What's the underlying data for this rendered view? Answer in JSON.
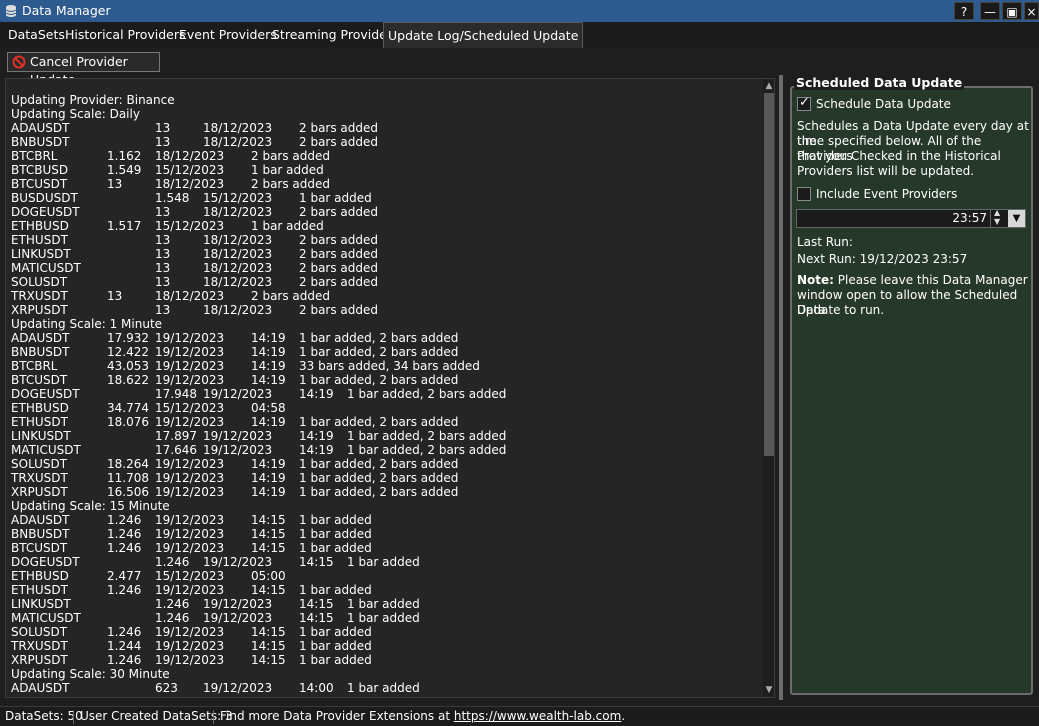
{
  "window": {
    "title": "Data Manager",
    "help": "?",
    "minimize": "—",
    "maximize": "▣",
    "close": "×"
  },
  "tabs": [
    {
      "label": "DataSets"
    },
    {
      "label": "Historical Providers"
    },
    {
      "label": "Event Providers"
    },
    {
      "label": "Streaming Providers"
    },
    {
      "label": "Update Log/Scheduled Update",
      "active": true
    }
  ],
  "toolbar": {
    "cancel_label": "Cancel Provider Update",
    "cancel_icon": "prohibited-icon"
  },
  "log": {
    "provider_line": "Updating Provider: Binance",
    "sections": [
      {
        "header": "Updating Scale: Daily",
        "rows": [
          [
            "ADAUSDT",
            "13",
            "18/12/2023",
            "",
            "2 bars added"
          ],
          [
            "BNBUSDT",
            "13",
            "18/12/2023",
            "",
            "2 bars added"
          ],
          [
            "BTCBRL",
            "1.162",
            "18/12/2023",
            "",
            "2 bars added"
          ],
          [
            "BTCBUSD",
            "1.549",
            "15/12/2023",
            "",
            "1 bar added"
          ],
          [
            "BTCUSDT",
            "13",
            "18/12/2023",
            "",
            "2 bars added"
          ],
          [
            "BUSDUSDT",
            "1.548",
            "15/12/2023",
            "",
            "1 bar added"
          ],
          [
            "DOGEUSDT",
            "13",
            "18/12/2023",
            "",
            "2 bars added"
          ],
          [
            "ETHBUSD",
            "1.517",
            "15/12/2023",
            "",
            "1 bar added"
          ],
          [
            "ETHUSDT",
            "13",
            "18/12/2023",
            "",
            "2 bars added"
          ],
          [
            "LINKUSDT",
            "13",
            "18/12/2023",
            "",
            "2 bars added"
          ],
          [
            "MATICUSDT",
            "13",
            "18/12/2023",
            "",
            "2 bars added"
          ],
          [
            "SOLUSDT",
            "13",
            "18/12/2023",
            "",
            "2 bars added"
          ],
          [
            "TRXUSDT",
            "13",
            "18/12/2023",
            "",
            "2 bars added"
          ],
          [
            "XRPUSDT",
            "13",
            "18/12/2023",
            "",
            "2 bars added"
          ]
        ]
      },
      {
        "header": "Updating Scale: 1 Minute",
        "rows": [
          [
            "ADAUSDT",
            "17.932",
            "19/12/2023",
            "14:19",
            "1 bar added, 2 bars added"
          ],
          [
            "BNBUSDT",
            "12.422",
            "19/12/2023",
            "14:19",
            "1 bar added, 2 bars added"
          ],
          [
            "BTCBRL",
            "43.053",
            "19/12/2023",
            "14:19",
            "33 bars added, 34 bars added"
          ],
          [
            "BTCUSDT",
            "18.622",
            "19/12/2023",
            "14:19",
            "1 bar added, 2 bars added"
          ],
          [
            "DOGEUSDT",
            "17.948",
            "19/12/2023",
            "14:19",
            "1 bar added, 2 bars added"
          ],
          [
            "ETHBUSD",
            "34.774",
            "15/12/2023",
            "04:58",
            ""
          ],
          [
            "ETHUSDT",
            "18.076",
            "19/12/2023",
            "14:19",
            "1 bar added, 2 bars added"
          ],
          [
            "LINKUSDT",
            "17.897",
            "19/12/2023",
            "14:19",
            "1 bar added, 2 bars added"
          ],
          [
            "MATICUSDT",
            "17.646",
            "19/12/2023",
            "14:19",
            "1 bar added, 2 bars added"
          ],
          [
            "SOLUSDT",
            "18.264",
            "19/12/2023",
            "14:19",
            "1 bar added, 2 bars added"
          ],
          [
            "TRXUSDT",
            "11.708",
            "19/12/2023",
            "14:19",
            "1 bar added, 2 bars added"
          ],
          [
            "XRPUSDT",
            "16.506",
            "19/12/2023",
            "14:19",
            "1 bar added, 2 bars added"
          ]
        ]
      },
      {
        "header": "Updating Scale: 15 Minute",
        "rows": [
          [
            "ADAUSDT",
            "1.246",
            "19/12/2023",
            "14:15",
            "1 bar added"
          ],
          [
            "BNBUSDT",
            "1.246",
            "19/12/2023",
            "14:15",
            "1 bar added"
          ],
          [
            "BTCUSDT",
            "1.246",
            "19/12/2023",
            "14:15",
            "1 bar added"
          ],
          [
            "DOGEUSDT",
            "1.246",
            "19/12/2023",
            "14:15",
            "1 bar added"
          ],
          [
            "ETHBUSD",
            "2.477",
            "15/12/2023",
            "05:00",
            ""
          ],
          [
            "ETHUSDT",
            "1.246",
            "19/12/2023",
            "14:15",
            "1 bar added"
          ],
          [
            "LINKUSDT",
            "1.246",
            "19/12/2023",
            "14:15",
            "1 bar added"
          ],
          [
            "MATICUSDT",
            "1.246",
            "19/12/2023",
            "14:15",
            "1 bar added"
          ],
          [
            "SOLUSDT",
            "1.246",
            "19/12/2023",
            "14:15",
            "1 bar added"
          ],
          [
            "TRXUSDT",
            "1.244",
            "19/12/2023",
            "14:15",
            "1 bar added"
          ],
          [
            "XRPUSDT",
            "1.246",
            "19/12/2023",
            "14:15",
            "1 bar added"
          ]
        ]
      },
      {
        "header": "Updating Scale: 30 Minute",
        "rows": [
          [
            "ADAUSDT",
            "623",
            "19/12/2023",
            "14:00",
            "1 bar added"
          ]
        ]
      }
    ]
  },
  "scheduled": {
    "group_title": "Scheduled Data Update",
    "schedule_label": "Schedule Data Update",
    "schedule_checked": true,
    "description": [
      "Schedules a Data Update every day at the",
      "time specified below. All of the Providers",
      "that you Checked in the Historical",
      "Providers list will be updated."
    ],
    "include_events_label": "Include Event Providers",
    "include_events_checked": false,
    "time_value": "23:57",
    "last_run": "Last Run:",
    "next_run": "Next Run: 19/12/2023 23:57",
    "note_bold": "Note:",
    "note_lines": [
      " Please leave this Data Manager",
      "window open to allow the Scheduled Data",
      "Update to run."
    ]
  },
  "status": {
    "datasets": "DataSets: 50",
    "user_datasets": "User Created DataSets: 3",
    "find_more": "Find more Data Provider Extensions at",
    "link": "https://www.wealth-lab.com",
    "period": "."
  }
}
